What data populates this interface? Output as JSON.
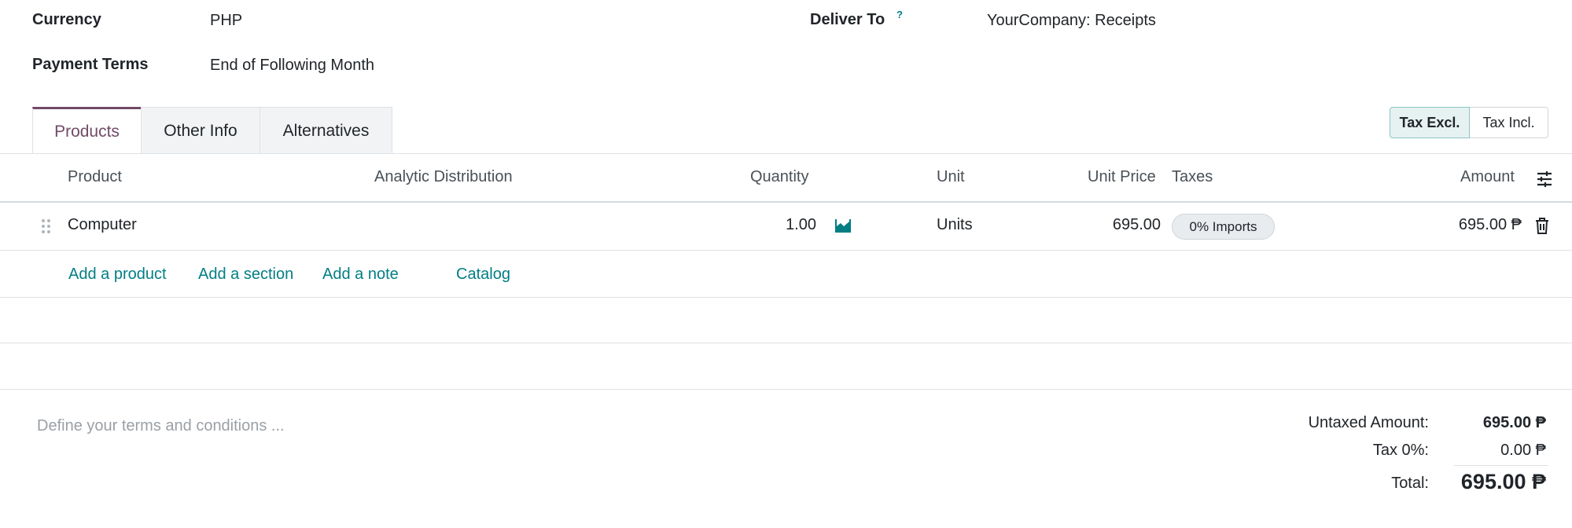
{
  "header": {
    "currency_label": "Currency",
    "currency_value": "PHP",
    "payment_terms_label": "Payment Terms",
    "payment_terms_value": "End of Following Month",
    "deliver_to_label": "Deliver To",
    "deliver_to_help": "?",
    "deliver_to_value": "YourCompany: Receipts"
  },
  "tabs": [
    {
      "label": "Products"
    },
    {
      "label": "Other Info"
    },
    {
      "label": "Alternatives"
    }
  ],
  "tax_toggle": {
    "excl": "Tax Excl.",
    "incl": "Tax Incl."
  },
  "table": {
    "headers": {
      "product": "Product",
      "analytic": "Analytic Distribution",
      "quantity": "Quantity",
      "unit": "Unit",
      "unit_price": "Unit Price",
      "taxes": "Taxes",
      "amount": "Amount"
    },
    "rows": [
      {
        "product": "Computer",
        "quantity": "1.00",
        "unit": "Units",
        "unit_price": "695.00",
        "tax": "0% Imports",
        "amount": "695.00 ₱"
      }
    ],
    "actions": {
      "add_product": "Add a product",
      "add_section": "Add a section",
      "add_note": "Add a note",
      "catalog": "Catalog"
    }
  },
  "terms_placeholder": "Define your terms and conditions ...",
  "totals": {
    "untaxed_label": "Untaxed Amount:",
    "untaxed_value": "695.00 ₱",
    "tax_label": "Tax 0%:",
    "tax_value": "0.00 ₱",
    "total_label": "Total:",
    "total_value": "695.00 ₱"
  },
  "colors": {
    "accent": "#017e84",
    "brand": "#714b67"
  }
}
